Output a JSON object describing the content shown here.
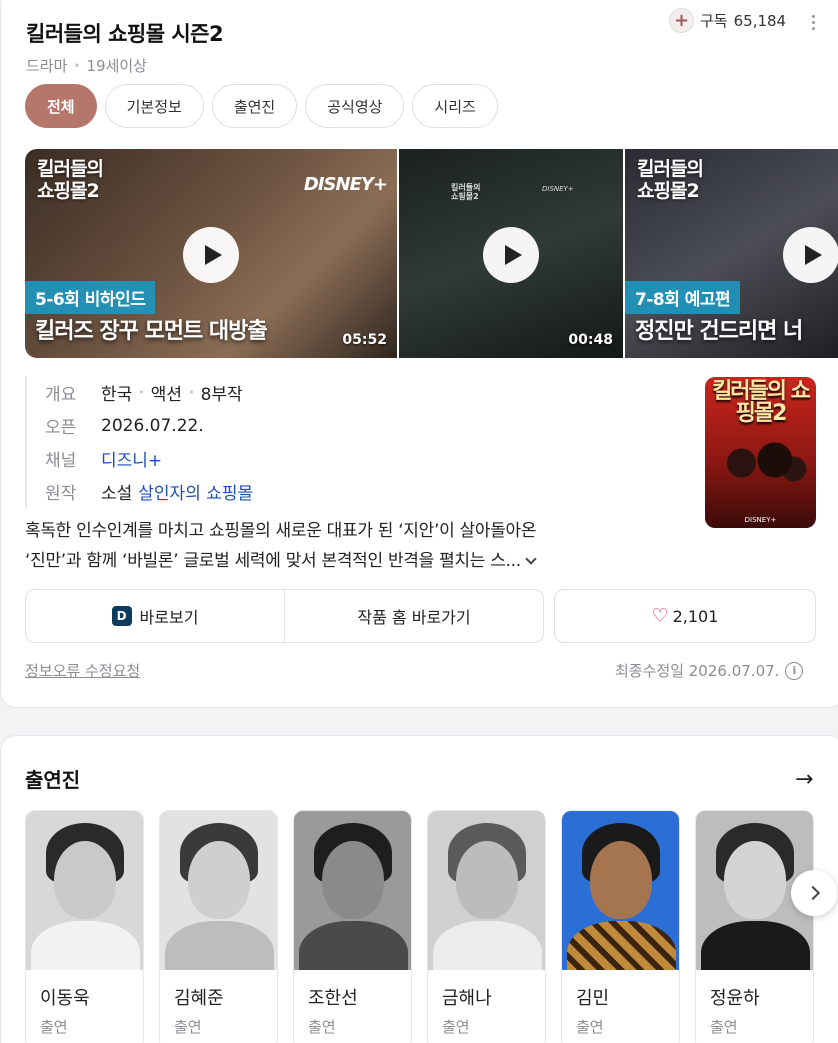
{
  "header": {
    "title": "킬러들의 쇼핑몰 시즌2",
    "genre": "드라마",
    "rating": "19세이상",
    "subscribe_label": "구독",
    "subscribe_count": "65,184"
  },
  "tabs": [
    {
      "label": "전체",
      "active": true
    },
    {
      "label": "기본정보"
    },
    {
      "label": "출연진"
    },
    {
      "label": "공식영상"
    },
    {
      "label": "시리즈"
    }
  ],
  "videos": [
    {
      "logo": "킬러들의\n쇼핑몰2",
      "brand": "DISNEY+",
      "episode_tag": "5-6회 비하인드",
      "caption": "킬러즈 장꾸 모먼트 대방출",
      "duration": "05:52"
    },
    {
      "duration": "00:48"
    },
    {
      "logo": "킬러들의\n쇼핑몰2",
      "episode_tag": "7-8회 예고편",
      "caption": "정진만 건드리면 너"
    }
  ],
  "info": {
    "overview_key": "개요",
    "overview_values": [
      "한국",
      "액션",
      "8부작"
    ],
    "open_key": "오픈",
    "open_value": "2026.07.22.",
    "channel_key": "채널",
    "channel_value": "디즈니+",
    "original_key": "원작",
    "original_type": "소설",
    "original_title": "살인자의 쇼핑몰"
  },
  "poster": {
    "title": "킬러들의 쇼핑몰2"
  },
  "synopsis": {
    "line1": "혹독한 인수인계를 마치고 쇼핑몰의 새로운 대표가 된 ‘지안’이 살아돌아온",
    "line2": "‘진만’과 함께 ‘바빌론’ 글로벌 세력에 맞서 본격적인 반격을 펼치는 스..."
  },
  "actions": {
    "watch_label": "바로보기",
    "home_label": "작품 홈 바로가기",
    "like_count": "2,101"
  },
  "footer": {
    "report_label": "정보오류 수정요청",
    "modified_label": "최종수정일 2026.07.07."
  },
  "cast_section": {
    "title": "출연진",
    "members": [
      {
        "name": "이동욱",
        "role": "출연"
      },
      {
        "name": "김혜준",
        "role": "출연"
      },
      {
        "name": "조한선",
        "role": "출연"
      },
      {
        "name": "금해나",
        "role": "출연"
      },
      {
        "name": "김민",
        "role": "출연"
      },
      {
        "name": "정윤하",
        "role": "출연"
      }
    ]
  },
  "colors": {
    "accent": "#b5776c",
    "link": "#1a4fb5",
    "heart": "#e0304b",
    "episode_tag": "#1e96be"
  }
}
